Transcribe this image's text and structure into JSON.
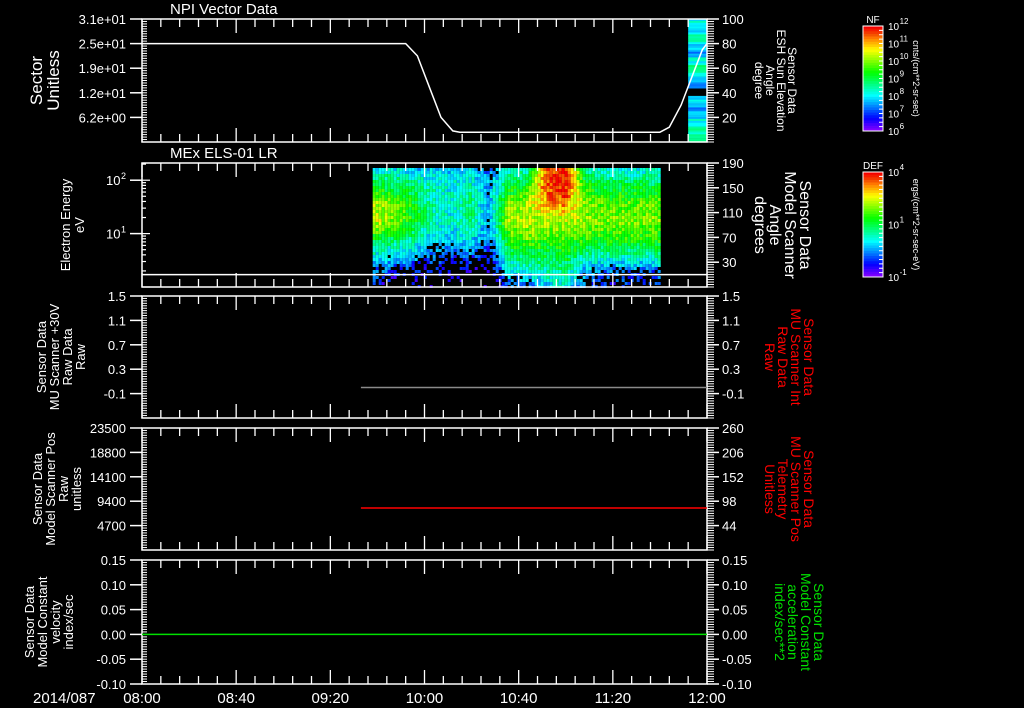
{
  "date_label": "2014/087",
  "time_axis": {
    "start": "08:00",
    "end": "12:00",
    "labels": [
      "08:00",
      "08:40",
      "09:20",
      "10:00",
      "10:40",
      "11:20",
      "12:00"
    ],
    "major_minutes": 40,
    "minor_minutes": 8
  },
  "colors": {
    "axes": "#ffffff",
    "red": "#ff0000",
    "green": "#00e000",
    "gray": "#8a8a8a"
  },
  "colorbars": [
    {
      "title": "NF",
      "units": "cnts/(cm**2-sr-sec)",
      "ticks": [
        "10^12",
        "10^11",
        "10^10",
        "10^9",
        "10^8",
        "10^7",
        "10^6"
      ],
      "scale": "log",
      "colormap": "rainbow"
    },
    {
      "title": "DEF",
      "units": "ergs/(cm**2-sr-sec-eV)",
      "ticks": [
        "10^4",
        "10^1",
        "10^-1"
      ],
      "scale": "log",
      "colormap": "rainbow"
    }
  ],
  "chart_data": [
    {
      "type": "line",
      "title": "NPI Vector Data",
      "ylabel_left": [
        "Sector",
        "Unitless"
      ],
      "ylabel_right": [
        "Sensor Data",
        "ESH Sun Elevation",
        "Angle",
        "degree"
      ],
      "left_axis": {
        "min": 0,
        "max": 31,
        "ticks": [
          {
            "v": 31,
            "t": "3.1e+01"
          },
          {
            "v": 24.8,
            "t": "2.5e+01"
          },
          {
            "v": 18.6,
            "t": "1.9e+01"
          },
          {
            "v": 12.4,
            "t": "1.2e+01"
          },
          {
            "v": 6.2,
            "t": "6.2e+00"
          }
        ]
      },
      "right_axis": {
        "min": 0,
        "max": 100,
        "ticks": [
          {
            "v": 100,
            "t": "100"
          },
          {
            "v": 80,
            "t": "80"
          },
          {
            "v": 60,
            "t": "60"
          },
          {
            "v": 40,
            "t": "40"
          },
          {
            "v": 20,
            "t": "20"
          }
        ]
      },
      "series": [
        {
          "axis": "right",
          "color": "#ffffff",
          "points": [
            [
              "08:00",
              80
            ],
            [
              "09:52",
              80
            ],
            [
              "09:57",
              70
            ],
            [
              "10:02",
              45
            ],
            [
              "10:07",
              20
            ],
            [
              "10:12",
              9
            ],
            [
              "10:15",
              8
            ],
            [
              "11:40",
              8
            ],
            [
              "11:44",
              12
            ],
            [
              "11:49",
              30
            ],
            [
              "11:54",
              55
            ],
            [
              "11:58",
              75
            ],
            [
              "12:00",
              80
            ]
          ]
        }
      ],
      "spectrogram": {
        "start": "11:52",
        "end": "12:00",
        "levels": [
          0.35,
          0.3,
          0.4,
          0.3,
          0.25,
          0.35,
          0.42,
          0.3,
          0.25,
          0.0,
          0.3,
          0.25,
          0.3,
          0.35,
          0.4,
          0.45
        ]
      }
    },
    {
      "type": "heatmap",
      "title": "MEx ELS-01 LR",
      "ylabel_left": [
        "Electron Energy",
        "eV"
      ],
      "ylabel_right": [
        "Sensor Data",
        "Model Scanner",
        "Angle",
        "degrees"
      ],
      "left_axis": {
        "scale": "log",
        "min": 1,
        "max": 210,
        "ticks": [
          {
            "v": 100,
            "t": "10^2"
          },
          {
            "v": 10,
            "t": "10^1"
          }
        ]
      },
      "right_axis": {
        "min": -10,
        "max": 190,
        "ticks": [
          {
            "v": 190,
            "t": "190"
          },
          {
            "v": 150,
            "t": "150"
          },
          {
            "v": 110,
            "t": "110"
          },
          {
            "v": 70,
            "t": "70"
          },
          {
            "v": 30,
            "t": "30"
          }
        ]
      },
      "series": [
        {
          "axis": "right",
          "color": "#ffffff",
          "points": [
            [
              "08:00",
              10
            ],
            [
              "12:00",
              10
            ]
          ]
        }
      ],
      "spectrogram": {
        "start": "09:38",
        "end": "11:40",
        "column_times": [
          "09:38",
          "09:46",
          "09:54",
          "10:02",
          "10:10",
          "10:18",
          "10:26",
          "10:34",
          "10:42",
          "10:50",
          "10:58",
          "11:06",
          "11:14",
          "11:22",
          "11:30",
          "11:38"
        ],
        "levels_top_to_bottom_energy": [
          [
            0.35,
            0.35,
            0.3,
            0.3,
            0.3,
            0.3,
            0.2,
            0.35,
            0.4,
            0.95,
            1.0,
            0.45,
            0.35,
            0.35,
            0.35,
            0.35
          ],
          [
            0.5,
            0.5,
            0.45,
            0.4,
            0.35,
            0.4,
            0.25,
            0.5,
            0.55,
            0.95,
            1.0,
            0.55,
            0.5,
            0.5,
            0.5,
            0.5
          ],
          [
            0.7,
            0.65,
            0.55,
            0.4,
            0.35,
            0.45,
            0.25,
            0.65,
            0.7,
            0.85,
            0.9,
            0.65,
            0.62,
            0.62,
            0.62,
            0.62
          ],
          [
            0.75,
            0.65,
            0.55,
            0.4,
            0.35,
            0.45,
            0.25,
            0.7,
            0.72,
            0.7,
            0.72,
            0.68,
            0.66,
            0.66,
            0.66,
            0.66
          ],
          [
            0.55,
            0.5,
            0.45,
            0.3,
            0.3,
            0.35,
            0.2,
            0.6,
            0.65,
            0.6,
            0.62,
            0.6,
            0.58,
            0.58,
            0.58,
            0.58
          ],
          [
            0.35,
            0.3,
            0.3,
            0.2,
            0.15,
            0.2,
            0.1,
            0.45,
            0.5,
            0.5,
            0.52,
            0.45,
            0.42,
            0.42,
            0.42,
            0.42
          ],
          [
            0.2,
            0.15,
            0.1,
            0.1,
            0.05,
            0.05,
            0.0,
            0.3,
            0.35,
            0.4,
            0.45,
            0.25,
            0.2,
            0.2,
            0.2,
            0.2
          ],
          [
            0.1,
            0.05,
            0.05,
            0.0,
            0.0,
            0.0,
            0.0,
            0.15,
            0.2,
            0.3,
            0.35,
            0.15,
            0.1,
            0.1,
            0.1,
            0.1
          ]
        ]
      }
    },
    {
      "type": "line",
      "title": "",
      "ylabel_left": [
        "Sensor Data",
        "MU Scanner +30V",
        "Raw Data",
        "Raw"
      ],
      "ylabel_right": [
        "Sensor Data",
        "MU Scanner Int",
        "Raw Data",
        "Raw"
      ],
      "right_label_color": "#ff0000",
      "left_axis": {
        "min": -0.5,
        "max": 1.5,
        "ticks": [
          {
            "v": 1.5,
            "t": "1.5"
          },
          {
            "v": 1.1,
            "t": "1.1"
          },
          {
            "v": 0.7,
            "t": "0.7"
          },
          {
            "v": 0.3,
            "t": "0.3"
          },
          {
            "v": -0.1,
            "t": "-0.1"
          }
        ]
      },
      "right_axis": {
        "min": -0.5,
        "max": 1.5,
        "ticks": [
          {
            "v": 1.5,
            "t": "1.5"
          },
          {
            "v": 1.1,
            "t": "1.1"
          },
          {
            "v": 0.7,
            "t": "0.7"
          },
          {
            "v": 0.3,
            "t": "0.3"
          },
          {
            "v": -0.1,
            "t": "-0.1"
          }
        ]
      },
      "series": [
        {
          "axis": "right",
          "color": "#8a8a8a",
          "points": [
            [
              "09:33",
              0
            ],
            [
              "12:00",
              0
            ]
          ]
        }
      ]
    },
    {
      "type": "line",
      "title": "",
      "ylabel_left": [
        "Sensor Data",
        "Model Scanner Pos",
        "Raw",
        "unitless"
      ],
      "ylabel_right": [
        "Sensor Data",
        "MU Scanner Pos",
        "Telemetry",
        "Unitless"
      ],
      "right_label_color": "#ff0000",
      "left_axis": {
        "min": 0,
        "max": 23500,
        "ticks": [
          {
            "v": 23500,
            "t": "23500"
          },
          {
            "v": 18800,
            "t": "18800"
          },
          {
            "v": 14100,
            "t": "14100"
          },
          {
            "v": 9400,
            "t": "9400"
          },
          {
            "v": 4700,
            "t": "4700"
          }
        ]
      },
      "right_axis": {
        "min": -10,
        "max": 260,
        "ticks": [
          {
            "v": 260,
            "t": "260"
          },
          {
            "v": 206,
            "t": "206"
          },
          {
            "v": 152,
            "t": "152"
          },
          {
            "v": 98,
            "t": "98"
          },
          {
            "v": 44,
            "t": "44"
          }
        ]
      },
      "series": [
        {
          "axis": "right",
          "color": "#ff0000",
          "points": [
            [
              "09:33",
              83
            ],
            [
              "12:00",
              83
            ]
          ]
        }
      ]
    },
    {
      "type": "line",
      "title": "",
      "ylabel_left": [
        "Sensor Data",
        "Model Constant",
        "velocity",
        "index/sec"
      ],
      "ylabel_right": [
        "Sensor Data",
        "Model Constant",
        "acceleration",
        "index/sec**2"
      ],
      "right_label_color": "#00e000",
      "left_axis": {
        "min": -0.1,
        "max": 0.15,
        "ticks": [
          {
            "v": 0.15,
            "t": "0.15"
          },
          {
            "v": 0.1,
            "t": "0.10"
          },
          {
            "v": 0.05,
            "t": "0.05"
          },
          {
            "v": 0.0,
            "t": "0.00"
          },
          {
            "v": -0.05,
            "t": "-0.05"
          },
          {
            "v": -0.1,
            "t": "-0.10"
          }
        ]
      },
      "right_axis": {
        "min": -0.1,
        "max": 0.15,
        "ticks": [
          {
            "v": 0.15,
            "t": "0.15"
          },
          {
            "v": 0.1,
            "t": "0.10"
          },
          {
            "v": 0.05,
            "t": "0.05"
          },
          {
            "v": 0.0,
            "t": "0.00"
          },
          {
            "v": -0.05,
            "t": "-0.05"
          },
          {
            "v": -0.1,
            "t": "-0.10"
          }
        ]
      },
      "series": [
        {
          "axis": "left",
          "color": "#00e000",
          "points": [
            [
              "08:00",
              0
            ],
            [
              "12:00",
              0
            ]
          ]
        }
      ]
    }
  ]
}
